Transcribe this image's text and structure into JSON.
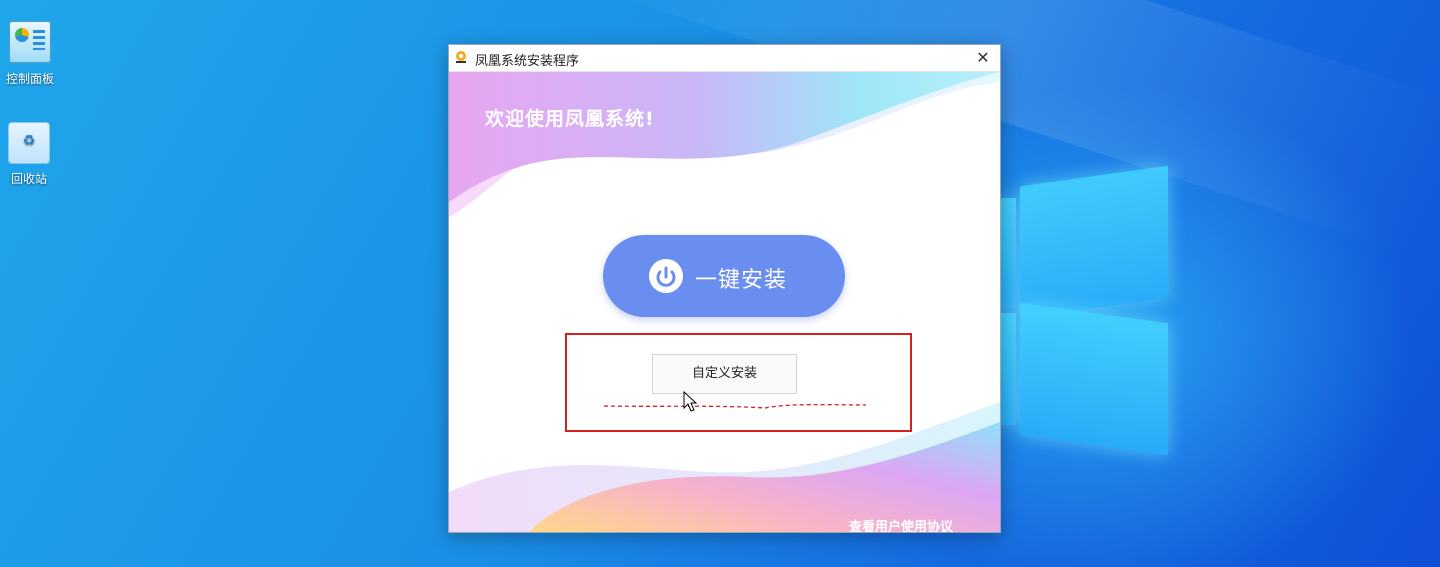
{
  "desktop": {
    "icons": [
      {
        "label": "控制面板",
        "icon": "control-panel-icon"
      },
      {
        "label": "回收站",
        "icon": "recycle-bin-icon"
      }
    ],
    "colors": {
      "background_start": "#1fa6ea",
      "background_end": "#0f4fd6"
    }
  },
  "installer": {
    "title": "凤凰系统安装程序",
    "close_glyph": "✕",
    "welcome_text": "欢迎使用凤凰系统!",
    "one_click_install_label": "一键安装",
    "custom_install_label": "自定义安装",
    "user_agreement_link": "查看用户使用协议",
    "colors": {
      "primary_button": "#6a8ef0",
      "highlight": "#d42020"
    }
  }
}
